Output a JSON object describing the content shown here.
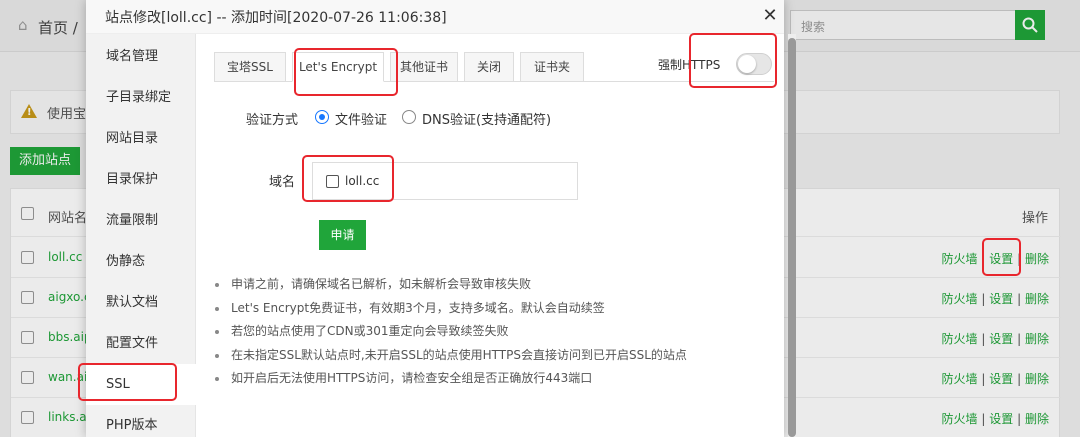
{
  "background": {
    "breadcrumb": "首页  /",
    "search_placeholder": "搜索",
    "warning_text": "使用宝塔",
    "add_site_label": "添加站点",
    "table_header_name": "网站名",
    "table_header_ops": "操作",
    "rows": [
      {
        "name": "loll.cc"
      },
      {
        "name": "aigxo.c"
      },
      {
        "name": "bbs.aip"
      },
      {
        "name": "wan.aip"
      },
      {
        "name": "links.ai"
      }
    ],
    "ops": {
      "firewall": "防火墙",
      "settings": "设置",
      "delete": "删除",
      "sep": "|"
    }
  },
  "modal": {
    "title": "站点修改[loll.cc] -- 添加时间[2020-07-26 11:06:38]",
    "close_glyph": "✕",
    "menu": [
      "域名管理",
      "子目录绑定",
      "网站目录",
      "目录保护",
      "流量限制",
      "伪静态",
      "默认文档",
      "配置文件",
      "SSL",
      "PHP版本"
    ],
    "active_menu_index": 8,
    "tabs": [
      "宝塔SSL",
      "Let's Encrypt",
      "其他证书",
      "关闭",
      "证书夹"
    ],
    "active_tab_index": 1,
    "force_https_label": "强制HTTPS",
    "force_https_enabled": false,
    "verify_label": "验证方式",
    "verify_options": [
      "文件验证",
      "DNS验证(支持通配符)"
    ],
    "verify_selected_index": 0,
    "domain_label": "域名",
    "domain_value": "loll.cc",
    "domain_checked": false,
    "apply_label": "申请",
    "notes": [
      "申请之前，请确保域名已解析，如未解析会导致审核失败",
      "Let's Encrypt免费证书，有效期3个月，支持多域名。默认会自动续签",
      "若您的站点使用了CDN或301重定向会导致续签失败",
      "在未指定SSL默认站点时,未开启SSL的站点使用HTTPS会直接访问到已开启SSL的站点",
      "如开启后无法使用HTTPS访问，请检查安全组是否正确放行443端口"
    ]
  },
  "colors": {
    "accent_green": "#20a53a",
    "annotation_red": "#e8262d",
    "radio_blue": "#1677ff"
  }
}
